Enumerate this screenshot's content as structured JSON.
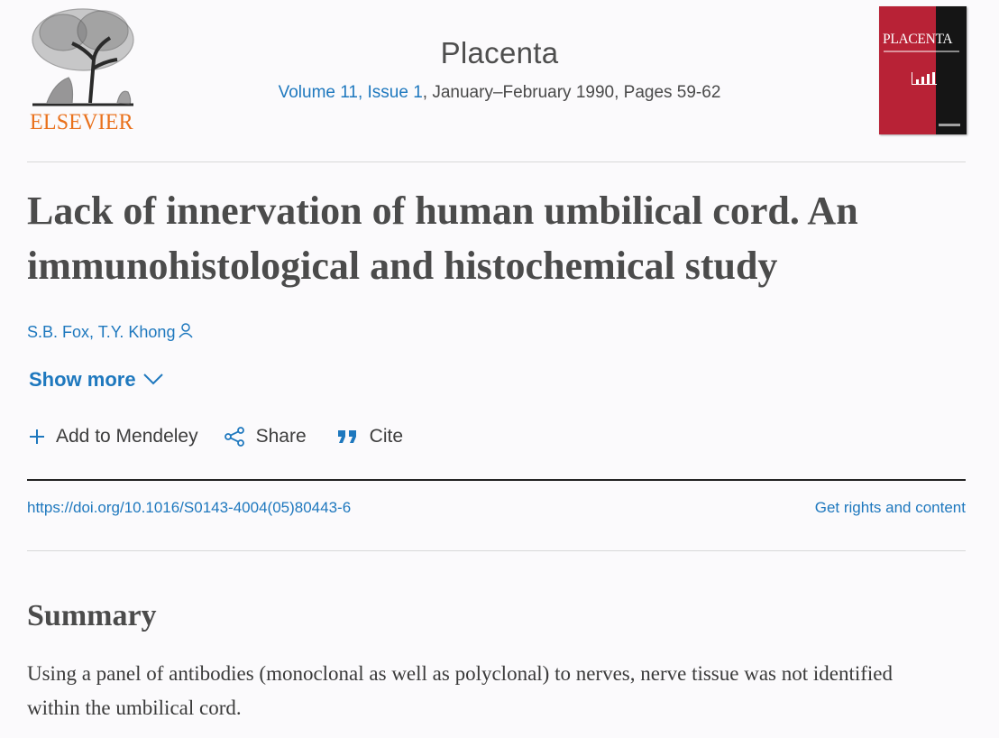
{
  "publisher": {
    "name": "ELSEVIER"
  },
  "journal": {
    "title": "Placenta",
    "volume_issue_link": "Volume 11, Issue 1",
    "issue_rest": ", January–February 1990, Pages 59-62",
    "cover_title": "PLACENTA"
  },
  "article": {
    "title": "Lack of innervation of human umbilical cord. An immunohistological and histochemical study",
    "authors": [
      "S.B. Fox",
      "T.Y. Khong"
    ],
    "author_separator": ", ",
    "show_more_label": "Show more"
  },
  "actions": [
    {
      "label": "Add to Mendeley",
      "icon": "plus-icon"
    },
    {
      "label": "Share",
      "icon": "share-icon"
    },
    {
      "label": "Cite",
      "icon": "quote-icon"
    }
  ],
  "doi": "https://doi.org/10.1016/S0143-4004(05)80443-6",
  "rights_label": "Get rights and content",
  "summary": {
    "heading": "Summary",
    "text": "Using a panel of antibodies (monoclonal as well as polyclonal) to nerves, nerve tissue was not identified within the umbilical cord."
  },
  "colors": {
    "link": "#1e78be",
    "brand": "#e9711c",
    "cover": "#b82236"
  }
}
